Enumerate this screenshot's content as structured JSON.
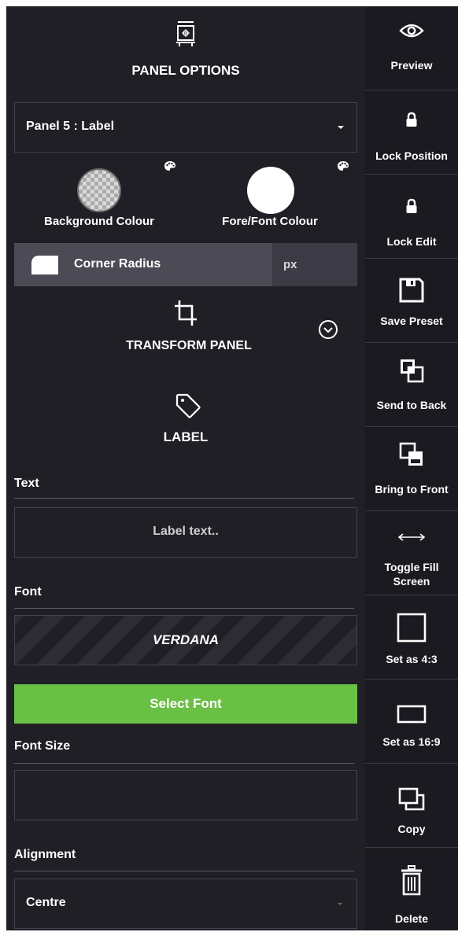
{
  "panel_options": {
    "title": "PANEL OPTIONS",
    "icon": "panel-settings-icon"
  },
  "panel_select": {
    "value": "Panel 5 : Label"
  },
  "colours": {
    "background_label": "Background Colour",
    "background_value": "transparent",
    "font_label": "Fore/Font Colour",
    "font_value": "#ffffff",
    "palette_icon": "palette-icon"
  },
  "corner_radius": {
    "label": "Corner Radius",
    "value": "",
    "unit": "px"
  },
  "transform": {
    "title": "TRANSFORM PANEL",
    "icon": "crop-icon",
    "expand_icon": "chevron-down-circle-icon"
  },
  "label_section": {
    "title": "LABEL",
    "icon": "tag-icon"
  },
  "text_field": {
    "label": "Text",
    "placeholder": "Label text.."
  },
  "font": {
    "label": "Font",
    "value": "VERDANA",
    "select_button": "Select Font"
  },
  "font_size": {
    "label": "Font Size",
    "value": ""
  },
  "alignment": {
    "label": "Alignment",
    "value": "Centre"
  },
  "toolbar": [
    {
      "label": "Preview",
      "icon": "eye-icon"
    },
    {
      "label": "Lock Position",
      "icon": "lock-icon"
    },
    {
      "label": "Lock Edit",
      "icon": "lock-icon"
    },
    {
      "label": "Save Preset",
      "icon": "save-icon"
    },
    {
      "label": "Send to Back",
      "icon": "send-to-back-icon"
    },
    {
      "label": "Bring to Front",
      "icon": "bring-to-front-icon"
    },
    {
      "label": "Toggle Fill Screen",
      "icon": "horizontal-arrows-icon"
    },
    {
      "label": "Set as 4:3",
      "icon": "square-icon"
    },
    {
      "label": "Set as 16:9",
      "icon": "rectangle-icon"
    },
    {
      "label": "Copy",
      "icon": "copy-icon"
    },
    {
      "label": "Delete",
      "icon": "trash-icon"
    }
  ],
  "colors": {
    "panel_bg": "#201f26",
    "toolbar_bg": "#1b1a20",
    "accent_green": "#6abf45",
    "radius_bar": "#4b4a55"
  }
}
